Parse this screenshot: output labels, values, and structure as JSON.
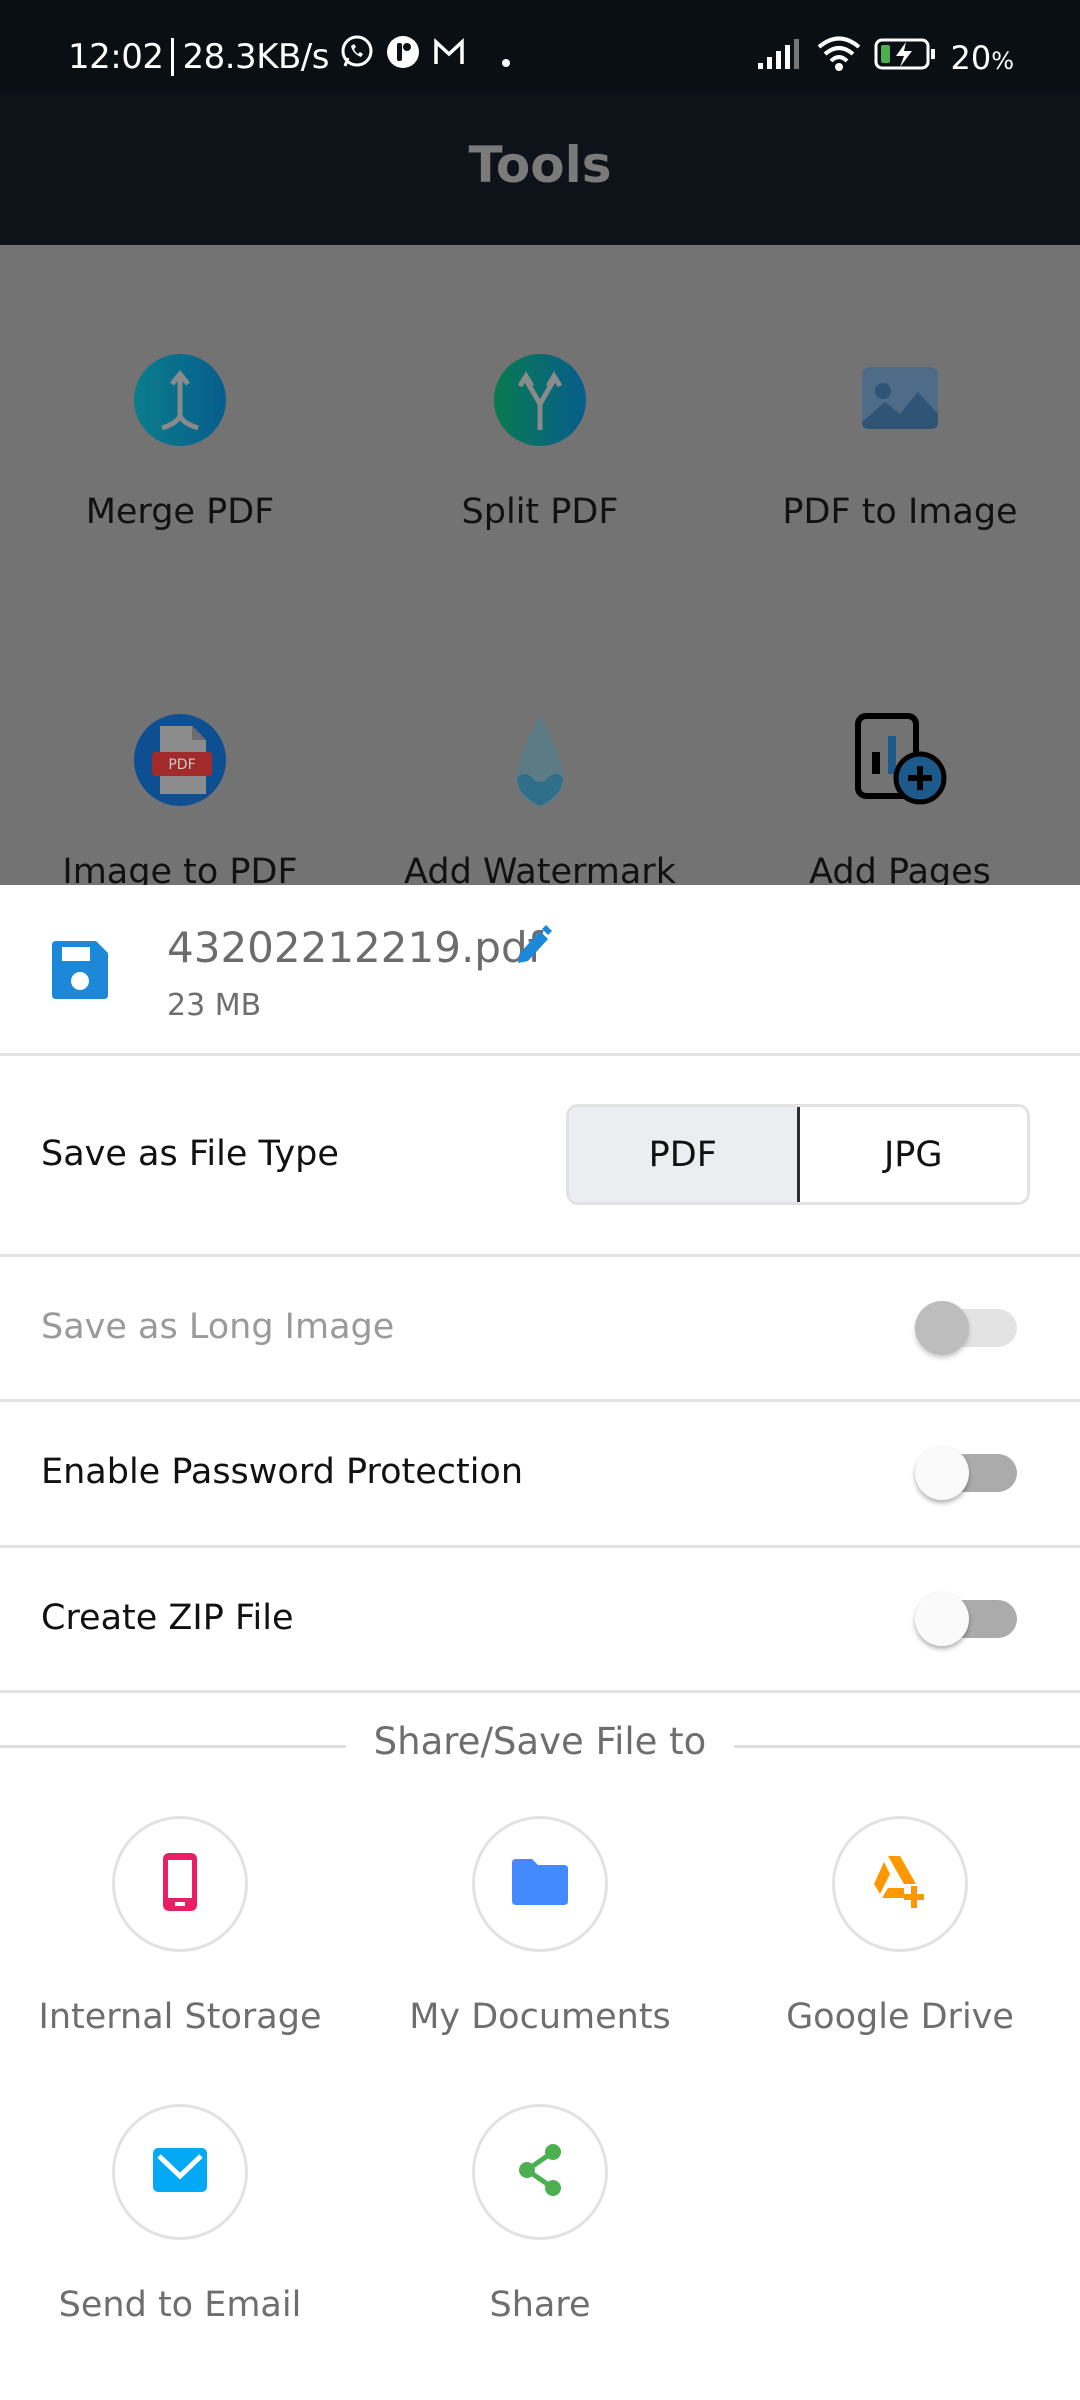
{
  "status_bar": {
    "time": "12:02",
    "net_speed": "28.3KB/s",
    "battery": "20",
    "battery_unit": "%",
    "notification_icons": [
      "whatsapp-icon",
      "app-icon",
      "gmail-icon",
      "dot-icon"
    ],
    "system_icons": [
      "signal-icon",
      "wifi-icon",
      "battery-charging-icon"
    ]
  },
  "app_bar": {
    "title": "Tools"
  },
  "tools": [
    {
      "label": "Merge PDF",
      "icon": "merge-icon"
    },
    {
      "label": "Split PDF",
      "icon": "split-icon"
    },
    {
      "label": "PDF to Image",
      "icon": "image-icon"
    },
    {
      "label": "Image to PDF",
      "icon": "pdf-file-icon",
      "badge": "PDF"
    },
    {
      "label": "Add Watermark",
      "icon": "water-drop-icon"
    },
    {
      "label": "Add Pages",
      "icon": "add-pages-icon"
    }
  ],
  "sheet": {
    "file": {
      "name": "43202212219.pdf",
      "size": "23 MB"
    },
    "file_type": {
      "label": "Save as File Type",
      "options": [
        "PDF",
        "JPG"
      ],
      "selected": "PDF"
    },
    "toggles": [
      {
        "label": "Save as Long Image",
        "on": false,
        "enabled": false
      },
      {
        "label": "Enable Password Protection",
        "on": false,
        "enabled": true
      },
      {
        "label": "Create ZIP File",
        "on": false,
        "enabled": true
      }
    ],
    "share_header": "Share/Save File to",
    "destinations": [
      {
        "label": "Internal Storage",
        "icon": "phone-icon",
        "color": "#e91e63"
      },
      {
        "label": "My Documents",
        "icon": "folder-icon",
        "color": "#448aff"
      },
      {
        "label": "Google Drive",
        "icon": "google-drive-icon",
        "color": "#ff9800"
      },
      {
        "label": "Send to Email",
        "icon": "email-icon",
        "color": "#03a9f4"
      },
      {
        "label": "Share",
        "icon": "share-icon",
        "color": "#4caf50"
      }
    ]
  },
  "colors": {
    "accent": "#1e88d8",
    "overlay": "#737373",
    "appbar": "#0d1318"
  }
}
